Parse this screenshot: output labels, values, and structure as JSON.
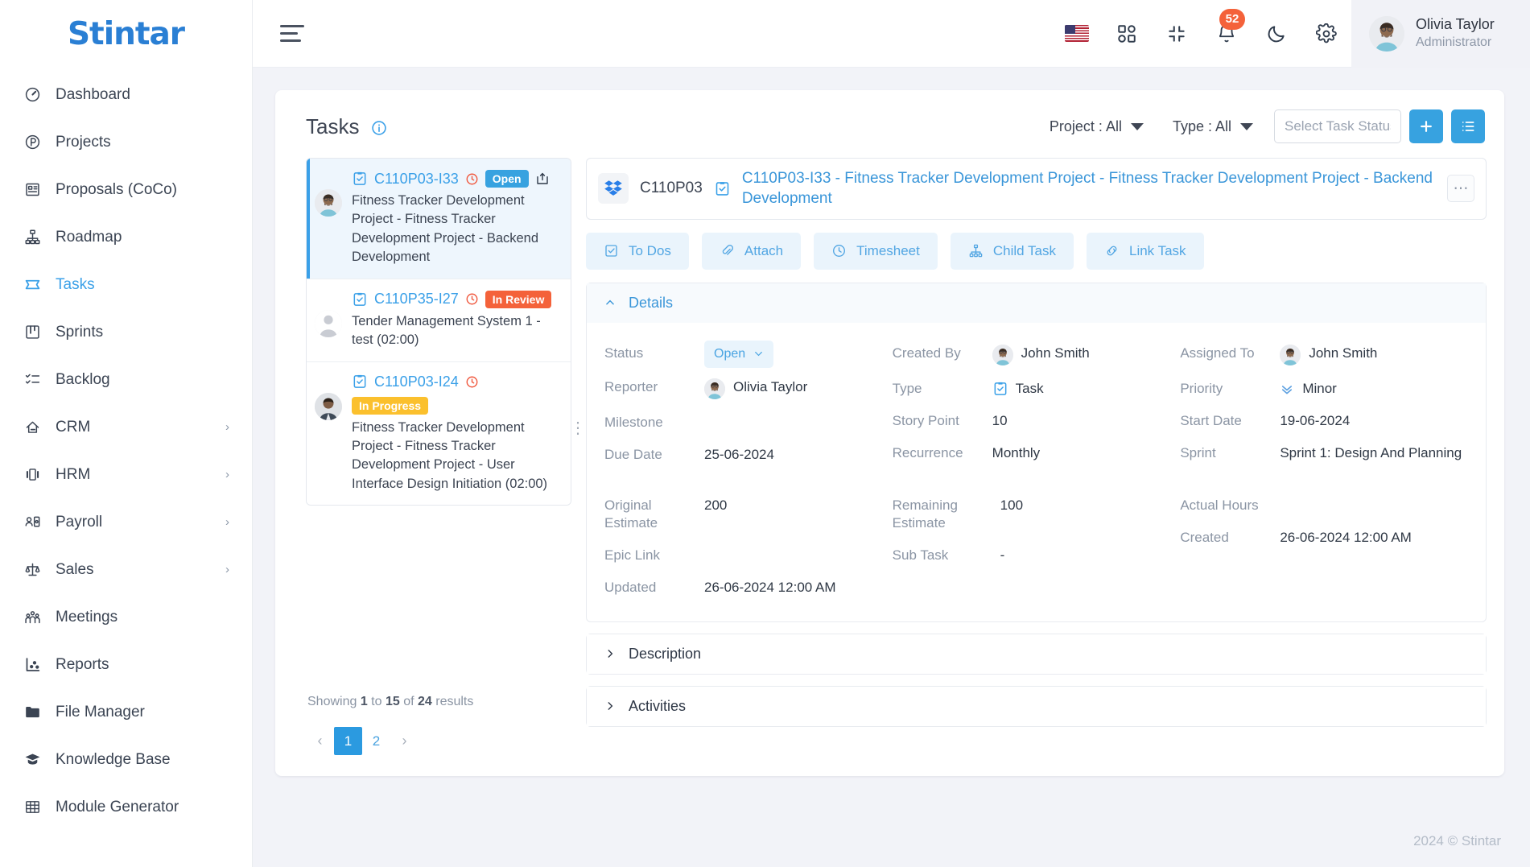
{
  "brand": {
    "name": "Stintar",
    "logo_color": "#3d8ddb"
  },
  "sidebar": {
    "items": [
      {
        "label": "Dashboard",
        "icon": "gauge-icon",
        "active": false,
        "expandable": false
      },
      {
        "label": "Projects",
        "icon": "circle-p-icon",
        "active": false,
        "expandable": false
      },
      {
        "label": "Proposals (CoCo)",
        "icon": "proposal-icon",
        "active": false,
        "expandable": false
      },
      {
        "label": "Roadmap",
        "icon": "roadmap-icon",
        "active": false,
        "expandable": false
      },
      {
        "label": "Tasks",
        "icon": "tasks-icon",
        "active": true,
        "expandable": false
      },
      {
        "label": "Sprints",
        "icon": "sprints-icon",
        "active": false,
        "expandable": false
      },
      {
        "label": "Backlog",
        "icon": "backlog-icon",
        "active": false,
        "expandable": false
      },
      {
        "label": "CRM",
        "icon": "crm-icon",
        "active": false,
        "expandable": true
      },
      {
        "label": "HRM",
        "icon": "hrm-icon",
        "active": false,
        "expandable": true
      },
      {
        "label": "Payroll",
        "icon": "payroll-icon",
        "active": false,
        "expandable": true
      },
      {
        "label": "Sales",
        "icon": "sales-icon",
        "active": false,
        "expandable": true
      },
      {
        "label": "Meetings",
        "icon": "meetings-icon",
        "active": false,
        "expandable": false
      },
      {
        "label": "Reports",
        "icon": "reports-icon",
        "active": false,
        "expandable": false
      },
      {
        "label": "File Manager",
        "icon": "folder-icon",
        "active": false,
        "expandable": false
      },
      {
        "label": "Knowledge Base",
        "icon": "graduation-cap-icon",
        "active": false,
        "expandable": false
      },
      {
        "label": "Module Generator",
        "icon": "grid-table-icon",
        "active": false,
        "expandable": false
      }
    ]
  },
  "topbar": {
    "menu_icon": "hamburger-icon",
    "language_icon": "us-flag-icon",
    "apps_icon": "apps-grid-icon",
    "fullscreen_icon": "collapse-screen-icon",
    "notifications_icon": "bell-icon",
    "notifications_count": "52",
    "theme_icon": "moon-icon",
    "settings_icon": "gear-icon",
    "user": {
      "name": "Olivia Taylor",
      "role": "Administrator",
      "avatar": "user-avatar"
    }
  },
  "page": {
    "title": "Tasks",
    "info_icon": "info-circle-icon",
    "filters": [
      {
        "label": "Project : All",
        "icon": "chevron-down-icon"
      },
      {
        "label": "Type : All",
        "icon": "chevron-down-icon"
      }
    ],
    "status_filter_placeholder": "Select Task Status",
    "status_filter_value": "",
    "add_button_icon": "plus-icon",
    "list_button_icon": "list-view-icon",
    "accent_color": "#37a2e0"
  },
  "task_list": {
    "items": [
      {
        "key": "C110P03-I33",
        "status": "Open",
        "status_class": "open",
        "title": "Fitness Tracker Development Project - Fitness Tracker Development Project - Backend Development",
        "selected": true,
        "has_share_icon": true,
        "avatar": "user-avatar"
      },
      {
        "key": "C110P35-I27",
        "status": "In Review",
        "status_class": "review",
        "title": "Tender Management System 1 - test (02:00)",
        "selected": false,
        "has_share_icon": false,
        "avatar": "placeholder-avatar"
      },
      {
        "key": "C110P03-I24",
        "status": "In Progress",
        "status_class": "progress",
        "title": "Fitness Tracker Development Project - Fitness Tracker Development Project - User Interface Design Initiation (02:00)",
        "selected": false,
        "has_share_icon": false,
        "avatar": "user-avatar"
      }
    ],
    "showing_text_prefix": "Showing ",
    "showing_from": "1",
    "showing_mid": " to ",
    "showing_to": "15",
    "showing_of": " of ",
    "showing_total": "24",
    "showing_suffix": " results",
    "pagination": {
      "prev": "‹",
      "pages": [
        "1",
        "2"
      ],
      "active_page": "1",
      "next": "›"
    }
  },
  "detail": {
    "project_code": "C110P03",
    "project_icon": "dropbox-logo-icon",
    "task_type_icon": "task-clipboard-icon",
    "title": "C110P03-I33 - Fitness Tracker Development Project - Fitness Tracker Development Project - Backend Development",
    "more_icon": "ellipsis-icon",
    "action_tabs": [
      {
        "label": "To Dos",
        "icon": "checkbox-icon"
      },
      {
        "label": "Attach",
        "icon": "paperclip-icon"
      },
      {
        "label": "Timesheet",
        "icon": "clock-icon"
      },
      {
        "label": "Child Task",
        "icon": "hierarchy-icon"
      },
      {
        "label": "Link Task",
        "icon": "link-icon"
      }
    ],
    "sections": {
      "details": {
        "label": "Details",
        "expanded": true,
        "icon": "chevron-up-icon"
      },
      "description": {
        "label": "Description",
        "expanded": false,
        "icon": "chevron-right-icon"
      },
      "activities": {
        "label": "Activities",
        "expanded": false,
        "icon": "chevron-right-icon"
      }
    },
    "fields": {
      "col1": [
        {
          "label": "Status",
          "value": "Open",
          "kind": "status-pill"
        },
        {
          "label": "Reporter",
          "value": "Olivia Taylor",
          "kind": "avatar"
        },
        {
          "label": "Milestone",
          "value": "",
          "kind": "text"
        },
        {
          "label": "Due Date",
          "value": "25-06-2024",
          "kind": "text"
        }
      ],
      "col2": [
        {
          "label": "Created By",
          "value": "John Smith",
          "kind": "avatar"
        },
        {
          "label": "Type",
          "value": "Task",
          "kind": "type-icon"
        },
        {
          "label": "Story Point",
          "value": "10",
          "kind": "text"
        },
        {
          "label": "Recurrence",
          "value": "Monthly",
          "kind": "text"
        }
      ],
      "col3": [
        {
          "label": "Assigned To",
          "value": "John Smith",
          "kind": "avatar"
        },
        {
          "label": "Priority",
          "value": "Minor",
          "kind": "priority"
        },
        {
          "label": "Start Date",
          "value": "19-06-2024",
          "kind": "text"
        },
        {
          "label": "Sprint",
          "value": "Sprint 1: Design And Planning",
          "kind": "text"
        }
      ],
      "row2_col1": [
        {
          "label": "Original Estimate",
          "value": "200",
          "kind": "text"
        },
        {
          "label": "Epic Link",
          "value": "",
          "kind": "text"
        },
        {
          "label": "Updated",
          "value": "26-06-2024 12:00 AM",
          "kind": "text"
        }
      ],
      "row2_col2": [
        {
          "label": "Remaining Estimate",
          "value": "100",
          "kind": "text"
        },
        {
          "label": "Sub Task",
          "value": "-",
          "kind": "text"
        }
      ],
      "row2_col3": [
        {
          "label": "Actual Hours",
          "value": "",
          "kind": "text"
        },
        {
          "label": "Created",
          "value": "26-06-2024 12:00 AM",
          "kind": "text"
        }
      ]
    }
  },
  "footer": {
    "copyright": "2024 © Stintar"
  }
}
